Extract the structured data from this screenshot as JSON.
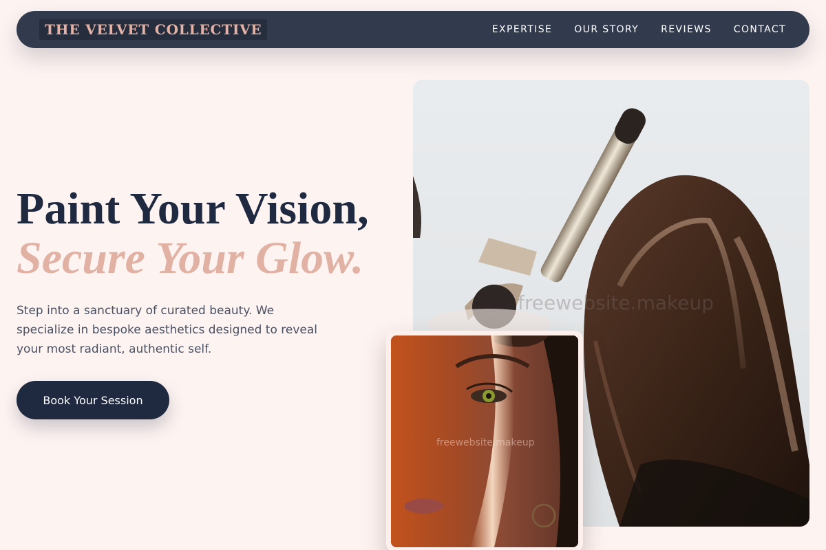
{
  "brand": {
    "name": "THE VELVET COLLECTIVE"
  },
  "nav": {
    "links": [
      {
        "label": "EXPERTISE"
      },
      {
        "label": "OUR STORY"
      },
      {
        "label": "REVIEWS"
      },
      {
        "label": "CONTACT"
      }
    ]
  },
  "hero": {
    "headline_line1": "Paint Your Vision,",
    "headline_line2": "Secure Your Glow.",
    "intro": "Step into a sanctuary of curated beauty. We specialize in bespoke aesthetics designed to reveal your most radiant, authentic self.",
    "cta_label": "Book Your Session"
  },
  "images": {
    "main_watermark": "freewebsite.makeup",
    "card_watermark": "freewebsite.makeup"
  },
  "colors": {
    "background": "#fdf3f1",
    "nav": "#323a4d",
    "navy": "#1f2a40",
    "accent": "#e1b1a4"
  }
}
